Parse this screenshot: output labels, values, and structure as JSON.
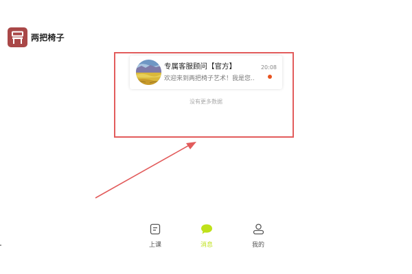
{
  "app": {
    "name": "两把椅子",
    "brand_color": "#a94747"
  },
  "chat_list": {
    "items": [
      {
        "name": "专属客服顾问【官方】",
        "preview": "欢迎来到两把椅子艺术！我是您...",
        "time": "20:08",
        "unread": true,
        "avatar_icon": "landscape-painting-avatar"
      }
    ],
    "empty_hint": "没有更多数据"
  },
  "annotation": {
    "frame_color": "#e25b5b",
    "arrow_color": "#e25b5b"
  },
  "tabbar": {
    "active_color": "#bfe11a",
    "items": [
      {
        "label": "上课",
        "icon": "lesson-icon",
        "active": false
      },
      {
        "label": "消息",
        "icon": "message-icon",
        "active": true
      },
      {
        "label": "我的",
        "icon": "profile-icon",
        "active": false
      }
    ]
  }
}
